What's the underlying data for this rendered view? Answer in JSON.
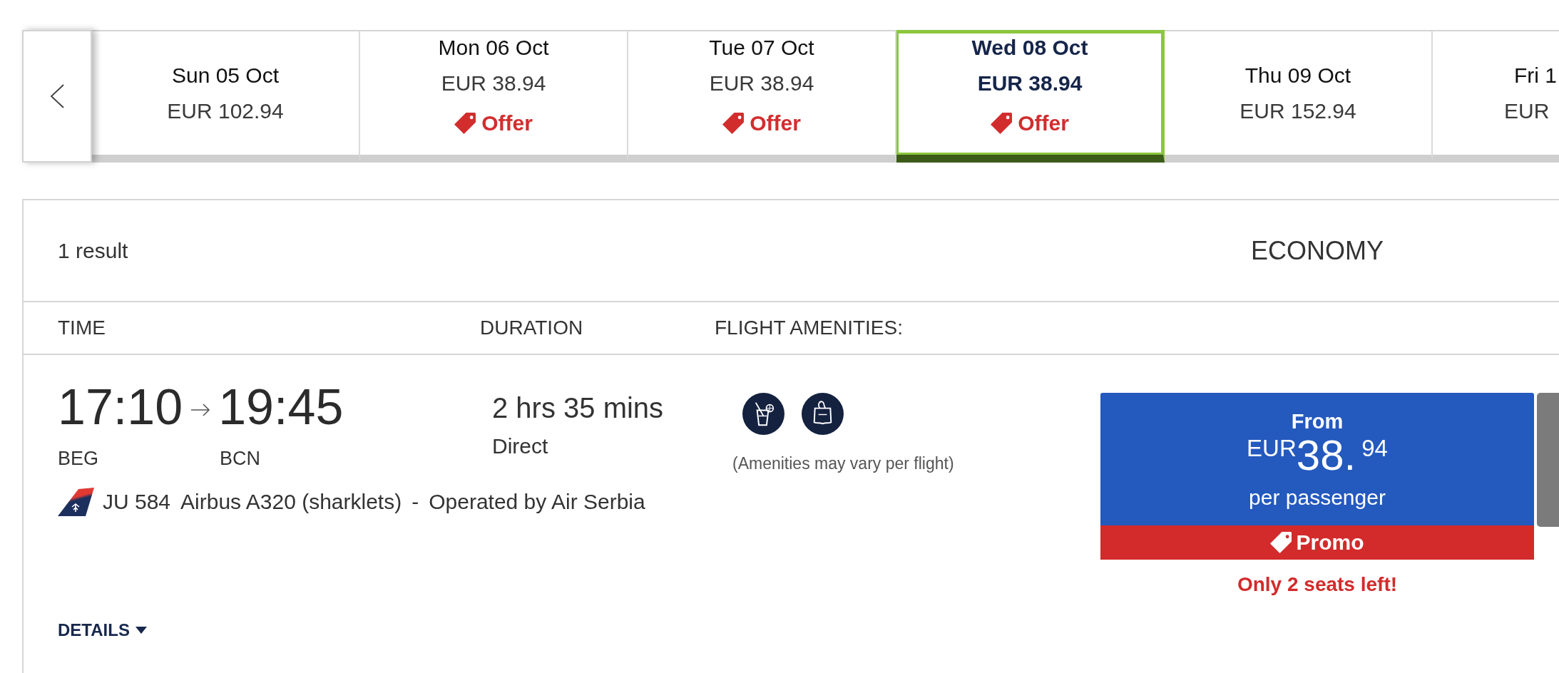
{
  "date_strip": {
    "dates": [
      {
        "date": "Sun 05 Oct",
        "price": "EUR 102.94",
        "selected": false
      },
      {
        "date": "Mon 06 Oct",
        "price": "EUR 38.94",
        "badge": "Offer",
        "selected": false
      },
      {
        "date": "Tue 07 Oct",
        "price": "EUR 38.94",
        "badge": "Offer",
        "selected": false
      },
      {
        "date": "Wed 08 Oct",
        "price": "EUR 38.94",
        "badge": "Offer",
        "selected": true
      },
      {
        "date": "Thu 09 Oct",
        "price": "EUR 152.94",
        "selected": false
      },
      {
        "date": "Fri 1",
        "price": "EUR",
        "selected": false
      }
    ]
  },
  "results": {
    "count": "1 result",
    "cabin": "ECONOMY",
    "columns": [
      "TIME",
      "DURATION",
      "FLIGHT AMENITIES:"
    ],
    "flights": [
      {
        "departure_time": "17:10",
        "arrival_time": "19:45",
        "origin": "BEG",
        "destination": "BCN",
        "duration": "2 hrs 35 mins",
        "stops": "Direct",
        "flight_number": "JU 584",
        "aircraft": "Airbus A320 (sharklets)",
        "separator": "-",
        "operator": "Operated by Air Serbia",
        "amenities": [
          {
            "kind": "drink"
          },
          {
            "kind": "snack"
          }
        ],
        "amenities_note": "(Amenities may vary per flight)",
        "fare": {
          "label": "From",
          "currency": "EUR",
          "amount": "38.",
          "cents": "94",
          "unit": "per passenger",
          "badge": "Promo",
          "notice": "Only 2 seats left!"
        },
        "details_link": "DETAILS"
      }
    ]
  }
}
